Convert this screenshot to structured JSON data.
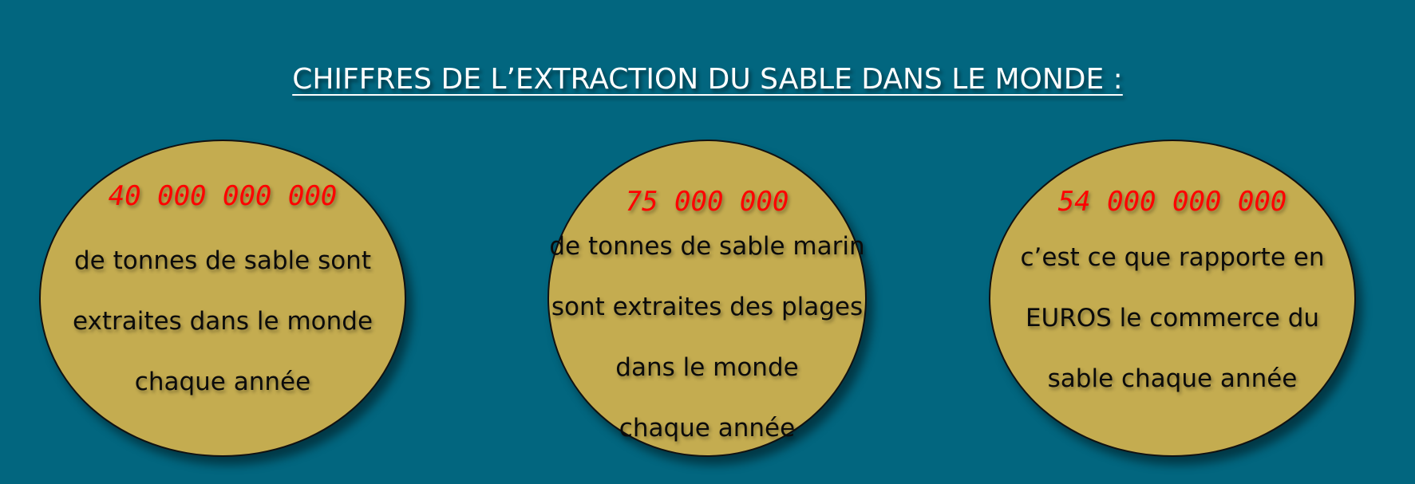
{
  "title": "CHIFFRES DE L’EXTRACTION DU SABLE DANS LE MONDE :",
  "colors": {
    "background": "#02667f",
    "bubble": "#c4ac50",
    "number": "#ff0000",
    "text": "#0b0b0b",
    "title": "#ffffff"
  },
  "bubbles": [
    {
      "number": "40 000 000 000",
      "lines": [
        "de tonnes de sable sont",
        "extraites dans le monde",
        "chaque année"
      ]
    },
    {
      "number": "75 000 000",
      "lines": [
        "de tonnes de sable marin",
        "sont extraites des plages",
        "dans le monde",
        "chaque année"
      ]
    },
    {
      "number": "54 000 000 000",
      "lines": [
        "c’est ce que rapporte en",
        "EUROS le commerce du",
        "sable chaque année"
      ]
    }
  ]
}
